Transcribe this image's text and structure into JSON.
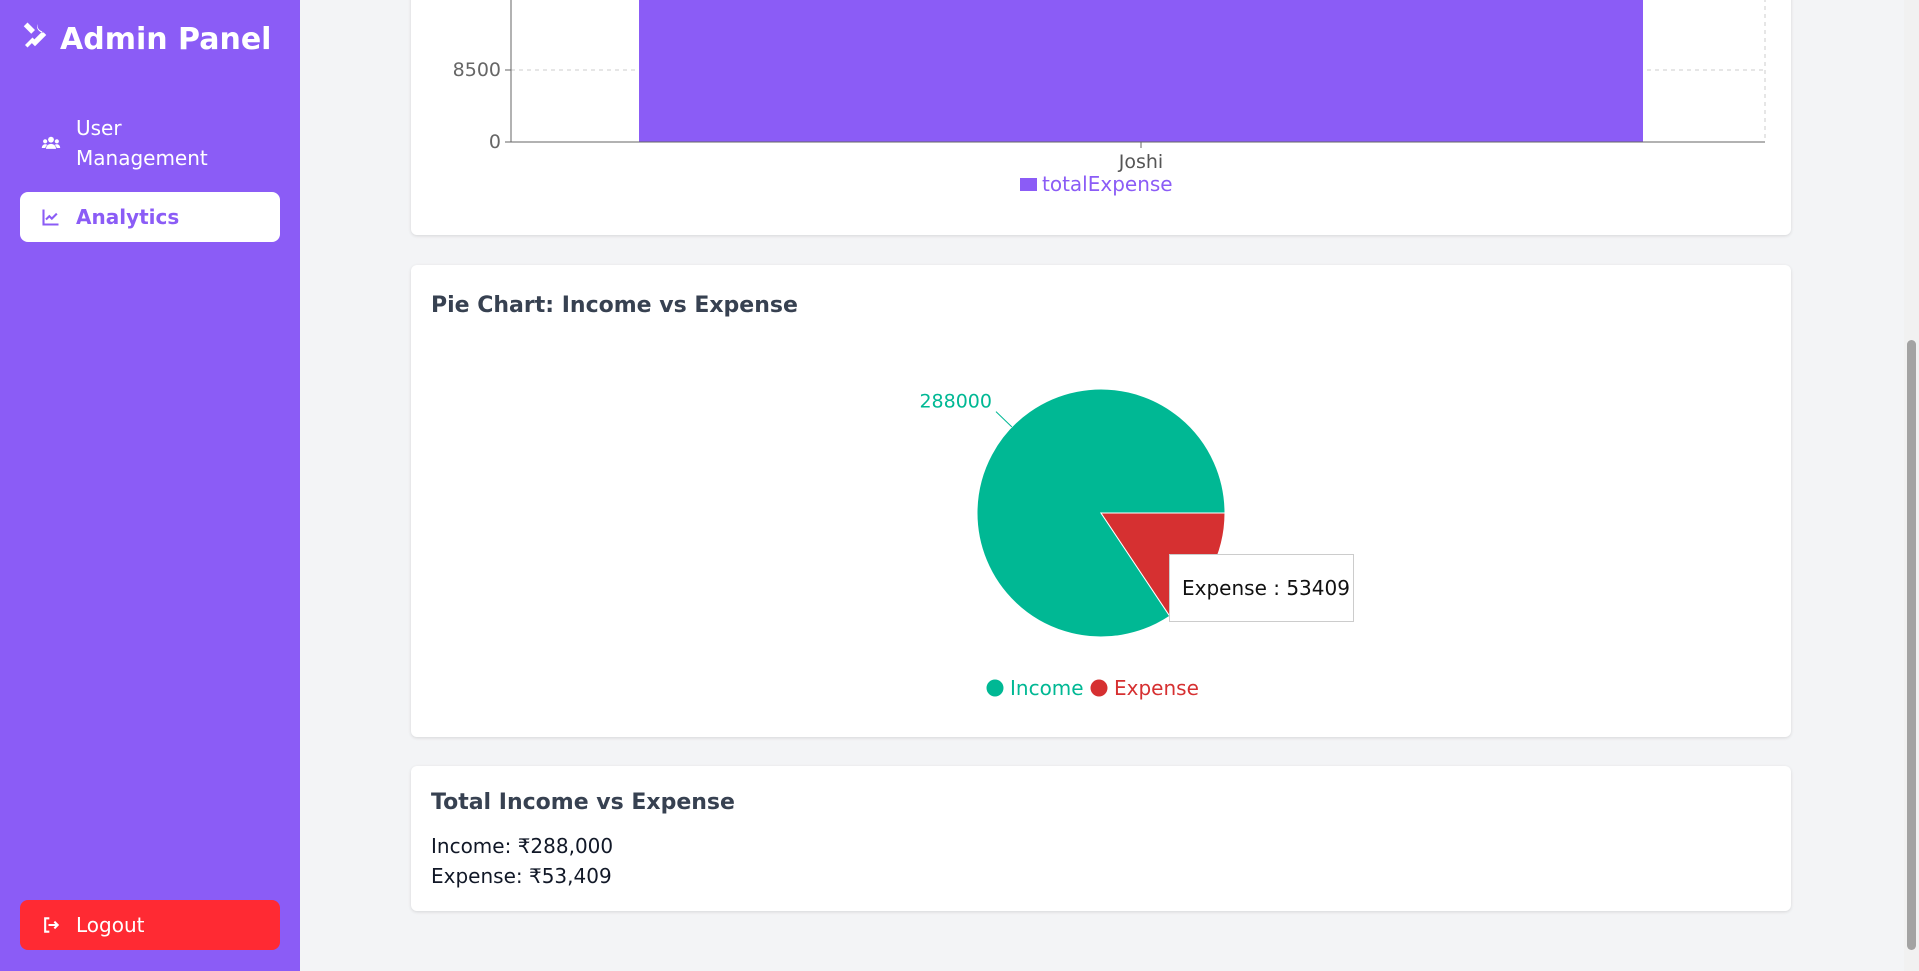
{
  "sidebar": {
    "brand": "Admin Panel",
    "items": [
      {
        "label": "User Management",
        "icon": "users-icon",
        "active": false
      },
      {
        "label": "Analytics",
        "icon": "chart-line-icon",
        "active": true
      }
    ],
    "logout_label": "Logout",
    "colors": {
      "background": "#8b5cf6",
      "logout": "#ff2a33"
    }
  },
  "bar_card": {
    "legend_label": "totalExpense"
  },
  "pie_card": {
    "title": "Pie Chart: Income vs Expense",
    "slice_label": "288000",
    "tooltip": "Expense : 53409",
    "legend": [
      "Income",
      "Expense"
    ]
  },
  "total_card": {
    "title": "Total Income vs Expense",
    "income_line": "Income: ₹288,000",
    "expense_line": "Expense: ₹53,409"
  },
  "chart_data": [
    {
      "type": "bar",
      "categories": [
        "Joshi"
      ],
      "series": [
        {
          "name": "totalExpense",
          "values": [
            53409
          ],
          "color": "#8b5cf6"
        }
      ],
      "y_ticks_visible": [
        0,
        8500
      ],
      "grid": true,
      "legend_position": "bottom"
    },
    {
      "type": "pie",
      "labels": [
        "Income",
        "Expense"
      ],
      "values": [
        288000,
        53409
      ],
      "colors": [
        "#00b894",
        "#d63031"
      ],
      "legend_position": "bottom"
    }
  ]
}
